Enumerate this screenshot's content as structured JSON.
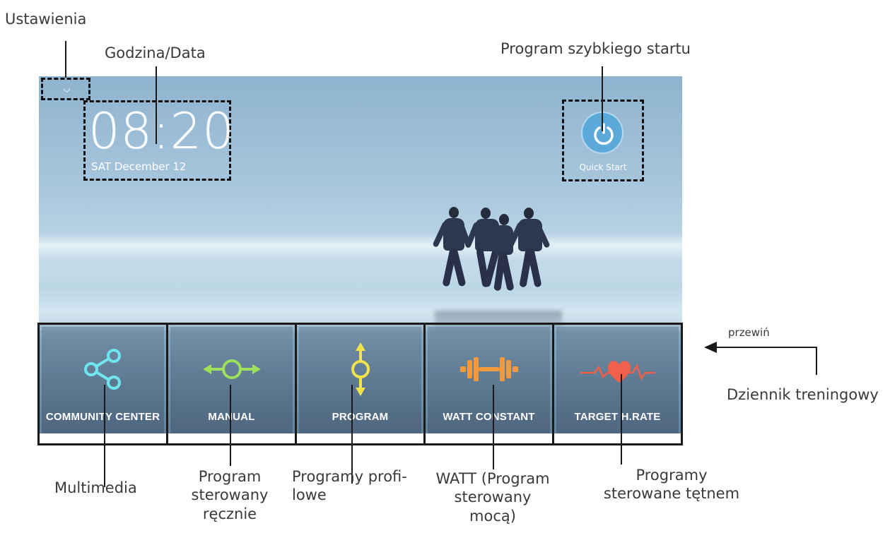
{
  "annotations": {
    "settings": "Ustawienia",
    "time_date": "Godzina/Data",
    "quick_start": "Program szybkiego startu",
    "scroll": "przewiń",
    "training_log": "Dziennik treningowy",
    "multimedia": "Multimedia",
    "manual_lines": [
      "Program",
      "sterowany",
      "ręcznie"
    ],
    "profile_lines": [
      "Programy profi-",
      "lowe"
    ],
    "watt_lines": [
      "WATT (Program",
      "sterowany",
      "mocą)"
    ],
    "heart_lines": [
      "Programy",
      "sterowane tętnem"
    ]
  },
  "screen": {
    "time": "08:20",
    "date": "SAT December 12",
    "quick_start_label": "Quick Start",
    "tiles": [
      {
        "label": "COMMUNITY CENTER",
        "icon": "share-icon",
        "color": "#6fe6ee"
      },
      {
        "label": "MANUAL",
        "icon": "manual-icon",
        "color": "#9ee05a"
      },
      {
        "label": "PROGRAM",
        "icon": "program-icon",
        "color": "#f2e34a"
      },
      {
        "label": "WATT CONSTANT",
        "icon": "dumbbell-icon",
        "color": "#f29a3c"
      },
      {
        "label": "TARGET H.RATE",
        "icon": "heart-rate-icon",
        "color": "#f0604a"
      }
    ]
  },
  "colors": {
    "quick_start_button": "#5aa9d8"
  }
}
